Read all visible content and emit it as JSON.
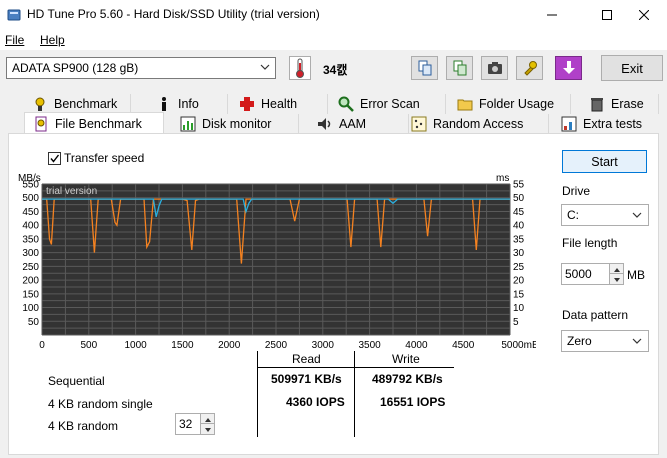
{
  "window": {
    "title": "HD Tune Pro 5.60 - Hard Disk/SSD Utility (trial version)"
  },
  "menu": {
    "file": "File",
    "help": "Help"
  },
  "toolbar": {
    "drive": "ADATA SP900 (128 gB)",
    "temperature": "34캜",
    "exit_label": "Exit"
  },
  "tabs_row1": [
    {
      "label": "Benchmark",
      "icon": "benchmark-icon"
    },
    {
      "label": "Info",
      "icon": "info-icon"
    },
    {
      "label": "Health",
      "icon": "health-cross-icon"
    },
    {
      "label": "Error Scan",
      "icon": "magnifier-icon"
    },
    {
      "label": "Folder Usage",
      "icon": "folder-icon"
    },
    {
      "label": "Erase",
      "icon": "trash-icon"
    }
  ],
  "tabs_row2": [
    {
      "label": "File Benchmark",
      "icon": "file-benchmark-icon",
      "active": true
    },
    {
      "label": "Disk monitor",
      "icon": "disk-monitor-icon"
    },
    {
      "label": "AAM",
      "icon": "speaker-icon"
    },
    {
      "label": "Random Access",
      "icon": "random-access-icon"
    },
    {
      "label": "Extra tests",
      "icon": "extra-tests-icon"
    }
  ],
  "options": {
    "transfer_speed_label": "Transfer speed",
    "transfer_speed_checked": true
  },
  "chart_data": {
    "type": "line",
    "watermark": "trial version",
    "left_unit": "MB/s",
    "right_unit": "ms",
    "x_unit": "mB",
    "x_ticks": [
      0,
      500,
      1000,
      1500,
      2000,
      2500,
      3000,
      3500,
      4000,
      4500,
      5000
    ],
    "y_left_ticks": [
      50,
      100,
      150,
      200,
      250,
      300,
      350,
      400,
      450,
      500,
      550
    ],
    "y_right_ticks": [
      5,
      10,
      15,
      20,
      25,
      30,
      35,
      40,
      45,
      50,
      55
    ],
    "ylim": [
      0,
      550
    ],
    "xlim": [
      0,
      5000
    ],
    "grid": true,
    "series": [
      {
        "color": "#f58220",
        "x": [
          0,
          50,
          80,
          100,
          130,
          200,
          400,
          520,
          560,
          600,
          680,
          740,
          780,
          800,
          840,
          1000,
          1090,
          1120,
          1150,
          1190,
          1300,
          1500,
          1550,
          1600,
          1640,
          1680,
          1800,
          2000,
          2080,
          2130,
          2180,
          2240,
          2400,
          2500,
          2650,
          2700,
          2750,
          2800,
          3000,
          3200,
          3260,
          3300,
          3340,
          3380,
          3500,
          3580,
          3620,
          3660,
          3700,
          3800,
          3900,
          4000,
          4080,
          4120,
          4160,
          4200,
          4300,
          4500,
          4600,
          4640,
          4680,
          4720,
          4800,
          5000
        ],
        "y": [
          495,
          495,
          350,
          330,
          495,
          495,
          495,
          495,
          300,
          495,
          495,
          495,
          410,
          400,
          495,
          495,
          495,
          320,
          340,
          495,
          495,
          495,
          490,
          310,
          490,
          495,
          495,
          495,
          495,
          260,
          495,
          495,
          495,
          495,
          495,
          415,
          495,
          495,
          495,
          495,
          495,
          320,
          495,
          495,
          495,
          495,
          320,
          495,
          495,
          495,
          495,
          495,
          495,
          360,
          495,
          495,
          495,
          495,
          495,
          310,
          495,
          495,
          495,
          495
        ]
      },
      {
        "color": "#2ab0e0",
        "x": [
          0,
          200,
          1190,
          1220,
          1250,
          1280,
          1400,
          2150,
          2180,
          2210,
          2240,
          2500,
          2800,
          2900,
          3300,
          3700,
          3750,
          3800,
          4000,
          4500,
          5000
        ],
        "y": [
          495,
          495,
          495,
          430,
          470,
          495,
          495,
          495,
          450,
          480,
          495,
          495,
          495,
          495,
          495,
          495,
          480,
          495,
          495,
          495,
          495
        ]
      }
    ]
  },
  "results": {
    "read_header": "Read",
    "write_header": "Write",
    "rows": [
      {
        "label": "Sequential",
        "read": "509971 KB/s",
        "write": "489792 KB/s"
      },
      {
        "label": "4 KB random single",
        "read": "4360 IOPS",
        "write": "16551 IOPS"
      },
      {
        "label": "4 KB random",
        "read": "",
        "write": ""
      }
    ],
    "queue_depth": "32"
  },
  "sidebar": {
    "start_label": "Start",
    "drive_label": "Drive",
    "drive_value": "C:",
    "file_length_label": "File length",
    "file_length_value": "5000",
    "file_length_unit": "MB",
    "data_pattern_label": "Data pattern",
    "data_pattern_value": "Zero"
  }
}
